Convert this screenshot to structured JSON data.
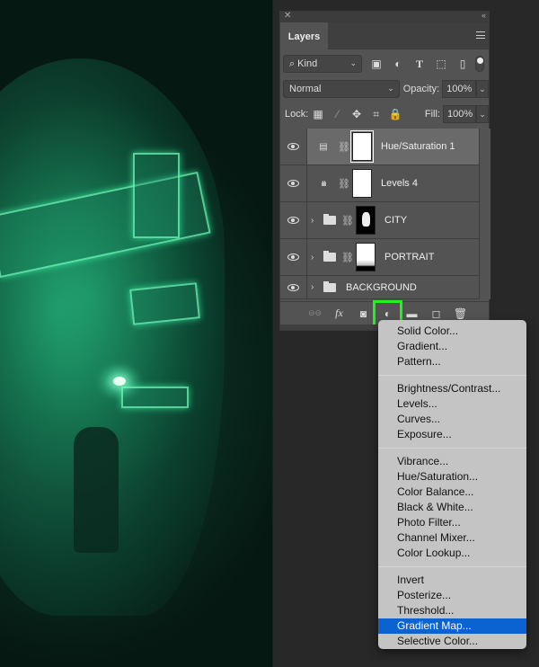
{
  "canvas": {
    "description": "Neon green city double-exposure portrait artwork"
  },
  "panel": {
    "close_glyph": "✕",
    "collapse_glyph": "‹‹",
    "tab_label": "Layers",
    "filter": {
      "kind_label": "Kind",
      "search_glyph": "⌕",
      "chevron": "⌄",
      "icons": [
        "image-filter",
        "adjustment-filter",
        "type-filter",
        "shape-filter",
        "smart-object-filter"
      ]
    },
    "blend_mode": "Normal",
    "opacity_label": "Opacity:",
    "opacity_value": "100%",
    "lock_label": "Lock:",
    "fill_label": "Fill:",
    "fill_value": "100%",
    "layers": [
      {
        "name": "Hue/Saturation 1",
        "type": "adjustment",
        "adj_glyph": "▤",
        "selected": true,
        "visible": true
      },
      {
        "name": "Levels 4",
        "type": "adjustment",
        "adj_glyph": "ılılı",
        "selected": false,
        "visible": true
      },
      {
        "name": "CITY",
        "type": "group",
        "selected": false,
        "visible": true
      },
      {
        "name": "PORTRAIT",
        "type": "group",
        "selected": false,
        "visible": true
      },
      {
        "name": "BACKGROUND",
        "type": "group",
        "selected": false,
        "visible": true
      }
    ],
    "footer": {
      "link": "⊖⊖",
      "fx": "fx",
      "mask": "◙",
      "adjustment": "◐",
      "group": "▬",
      "new_layer": "◻",
      "delete": "🗑"
    },
    "highlight_color": "#1ef51e"
  },
  "menu": {
    "groups": [
      [
        "Solid Color...",
        "Gradient...",
        "Pattern..."
      ],
      [
        "Brightness/Contrast...",
        "Levels...",
        "Curves...",
        "Exposure..."
      ],
      [
        "Vibrance...",
        "Hue/Saturation...",
        "Color Balance...",
        "Black & White...",
        "Photo Filter...",
        "Channel Mixer...",
        "Color Lookup..."
      ],
      [
        "Invert",
        "Posterize...",
        "Threshold...",
        "Gradient Map...",
        "Selective Color..."
      ]
    ],
    "active_item": "Gradient Map...",
    "active_color": "#0b62d1"
  }
}
